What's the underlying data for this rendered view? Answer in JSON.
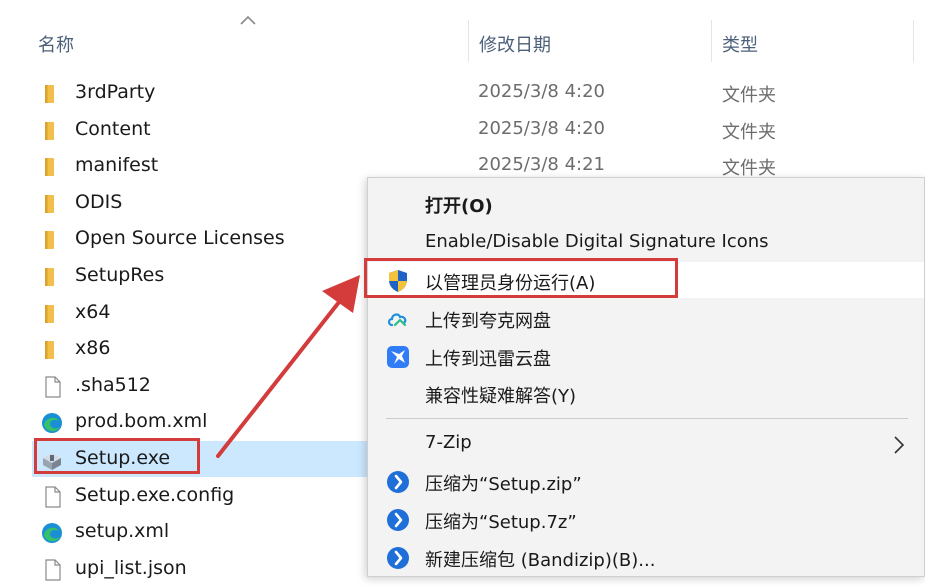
{
  "columns": {
    "name": "名称",
    "modified": "修改日期",
    "type": "类型"
  },
  "colors": {
    "folder": "#f2c04a",
    "selection": "#cce8ff",
    "highlight": "#d43b3b",
    "header_text": "#4c607a"
  },
  "files": [
    {
      "name": "3rdParty",
      "date": "2025/3/8 4:20",
      "type": "文件夹",
      "icon": "folder-icon"
    },
    {
      "name": "Content",
      "date": "2025/3/8 4:20",
      "type": "文件夹",
      "icon": "folder-icon"
    },
    {
      "name": "manifest",
      "date": "2025/3/8 4:21",
      "type": "文件夹",
      "icon": "folder-icon"
    },
    {
      "name": "ODIS",
      "icon": "folder-icon"
    },
    {
      "name": "Open Source Licenses",
      "icon": "folder-icon"
    },
    {
      "name": "SetupRes",
      "icon": "folder-icon"
    },
    {
      "name": "x64",
      "icon": "folder-icon"
    },
    {
      "name": "x86",
      "icon": "folder-icon"
    },
    {
      "name": ".sha512",
      "icon": "file-icon"
    },
    {
      "name": "prod.bom.xml",
      "icon": "edge-icon"
    },
    {
      "name": "Setup.exe",
      "icon": "installer-icon",
      "selected": true
    },
    {
      "name": "Setup.exe.config",
      "icon": "file-icon"
    },
    {
      "name": "setup.xml",
      "icon": "edge-icon"
    },
    {
      "name": "upi_list.json",
      "icon": "file-icon"
    }
  ],
  "context_menu": {
    "open": "打开(O)",
    "digital_signature": "Enable/Disable Digital Signature Icons",
    "run_as_admin": "以管理员身份运行(A)",
    "upload_quark": "上传到夸克网盘",
    "upload_xunlei": "上传到迅雷云盘",
    "compat": "兼容性疑难解答(Y)",
    "seven_zip": "7-Zip",
    "compress_zip": "压缩为“Setup.zip”",
    "compress_7z": "压缩为“Setup.7z”",
    "bandizip_new": "新建压缩包 (Bandizip)(B)..."
  }
}
